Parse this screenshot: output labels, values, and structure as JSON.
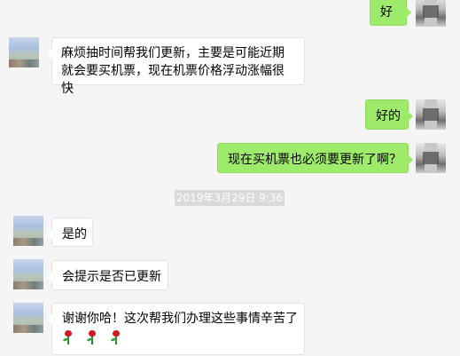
{
  "messages": [
    {
      "side": "right",
      "text": "好"
    },
    {
      "side": "left",
      "text": "麻烦抽时间帮我们更新，主要是可能近期就会要买机票，现在机票价格浮动涨幅很快"
    },
    {
      "side": "right",
      "text": "好的"
    },
    {
      "side": "right",
      "text": "现在买机票也必须要更新了啊？"
    },
    {
      "side": "left",
      "text": "是的"
    },
    {
      "side": "left",
      "text": "会提示是否已更新"
    },
    {
      "side": "left",
      "text": "谢谢你哈！这次帮我们办理这些事情辛苦了",
      "emojis": [
        "rose-icon",
        "rose-icon",
        "rose-icon"
      ]
    }
  ],
  "timestamp": "2019年3月29日 9:36",
  "colors": {
    "background": "#f5f5f5",
    "sent_bubble": "#9eea6a",
    "received_bubble": "#ffffff",
    "timestamp_bg": "#dadada"
  }
}
